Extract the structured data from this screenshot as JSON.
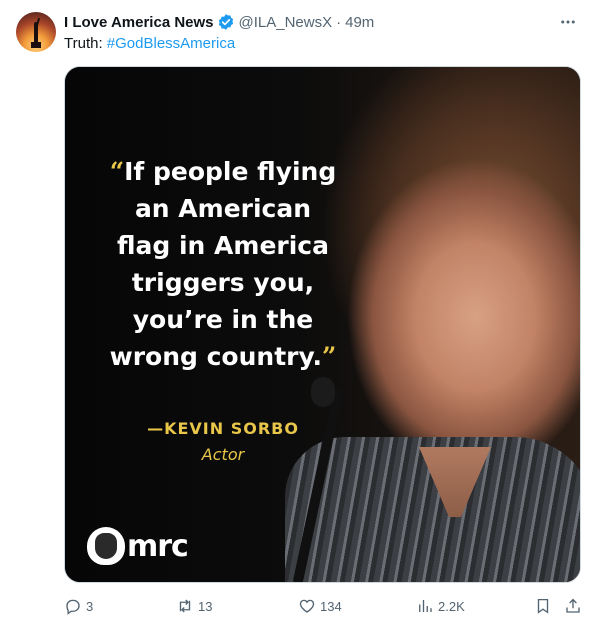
{
  "author": {
    "name": "I Love America News",
    "handle": "@ILA_NewsX",
    "separator": "·",
    "time": "49m"
  },
  "tweet": {
    "prefix": "Truth: ",
    "hashtag": "#GodBlessAmerica"
  },
  "media": {
    "quote_lines": [
      "If people flying",
      "an American",
      "flag in America",
      "triggers you,",
      "you’re in the",
      "wrong country."
    ],
    "open_quote": "“",
    "close_quote": "”",
    "attribution": "—KEVIN SORBO",
    "role": "Actor",
    "logo_text": "mrc"
  },
  "actions": {
    "reply_count": "3",
    "repost_count": "13",
    "like_count": "134",
    "views_count": "2.2K"
  },
  "colors": {
    "accent": "#1d9bf0",
    "quote_yellow": "#e8c64a",
    "muted": "#536471"
  },
  "icons": [
    "verified-badge-icon",
    "more-icon",
    "reply-icon",
    "repost-icon",
    "like-icon",
    "views-icon",
    "bookmark-icon",
    "share-icon"
  ]
}
